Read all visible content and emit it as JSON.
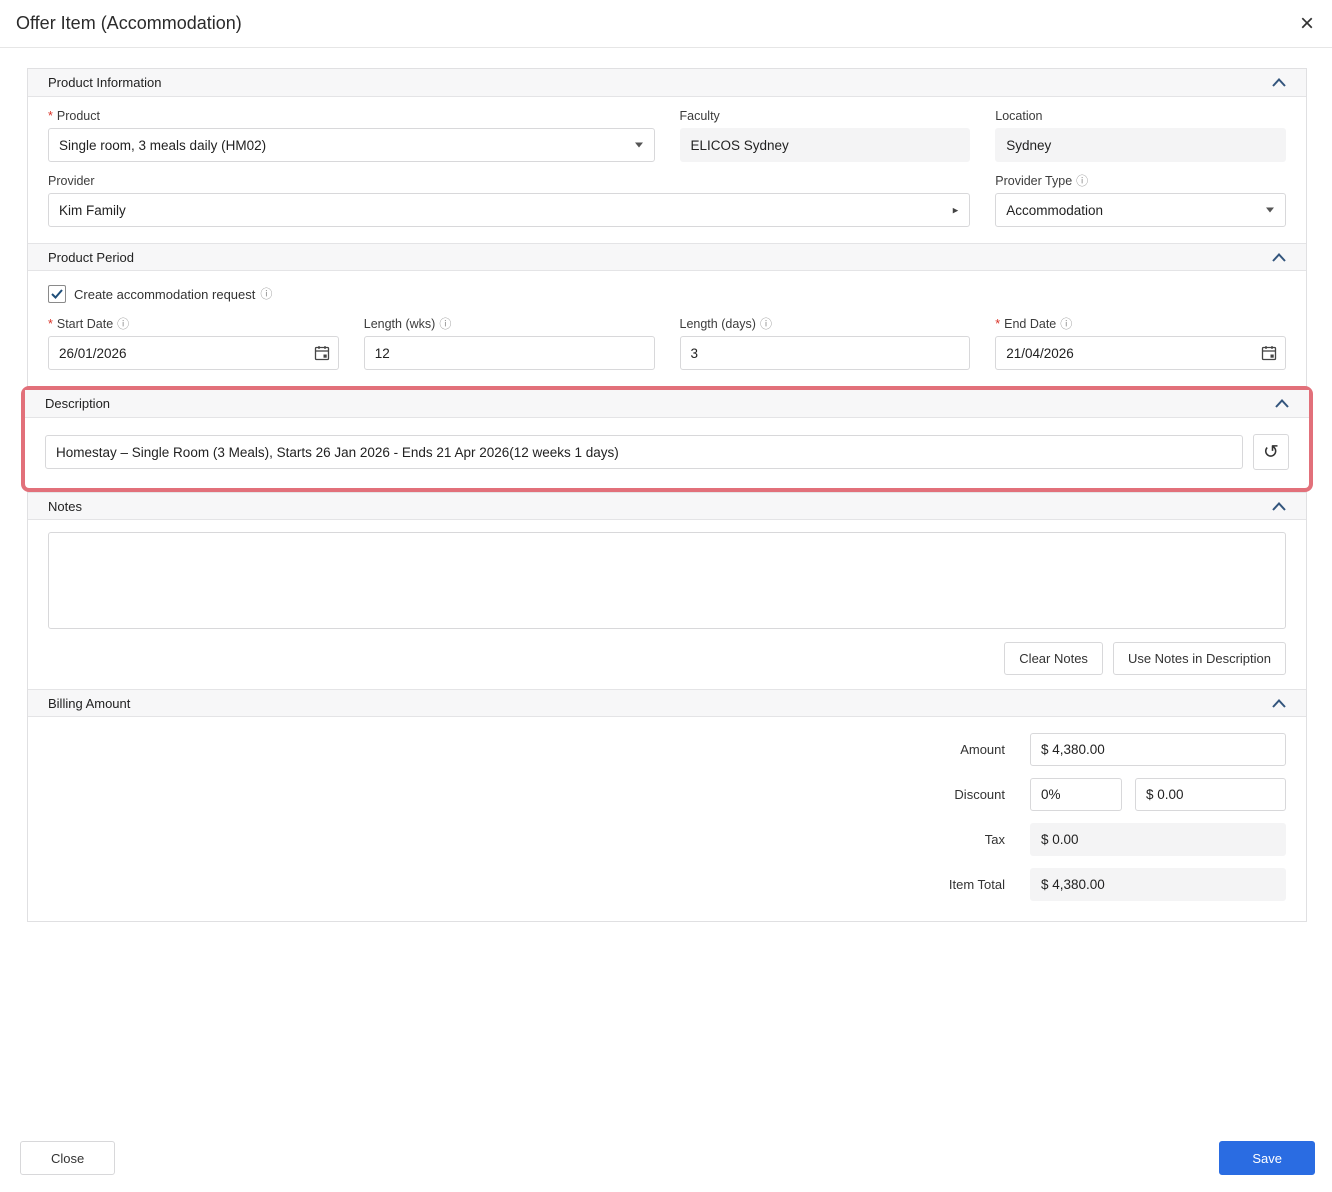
{
  "modal": {
    "title": "Offer Item (Accommodation)"
  },
  "icons": {
    "close": "×",
    "info": "ⓘ",
    "history": "↺",
    "provider_arrow": "▸"
  },
  "marks": {
    "required": "*"
  },
  "colors": {
    "accent": "#2a6ce2",
    "highlight_border": "#e2707a",
    "required": "#d93025",
    "chevron": "#33557d"
  },
  "product_information": {
    "title": "Product Information",
    "product": {
      "label": "Product",
      "value": "Single room, 3 meals daily (HM02)"
    },
    "faculty": {
      "label": "Faculty",
      "value": "ELICOS Sydney"
    },
    "location": {
      "label": "Location",
      "value": "Sydney"
    },
    "provider": {
      "label": "Provider",
      "value": "Kim Family"
    },
    "provider_type": {
      "label": "Provider Type",
      "value": "Accommodation"
    }
  },
  "product_period": {
    "title": "Product Period",
    "create_request_label": "Create accommodation request",
    "start_date": {
      "label": "Start Date",
      "value": "26/01/2026"
    },
    "length_wks": {
      "label": "Length (wks)",
      "value": "12"
    },
    "length_days": {
      "label": "Length (days)",
      "value": "3"
    },
    "end_date": {
      "label": "End Date",
      "value": "21/04/2026"
    }
  },
  "description": {
    "title": "Description",
    "value": "Homestay – Single Room (3 Meals), Starts 26 Jan 2026 - Ends 21 Apr 2026(12 weeks 1 days)"
  },
  "notes": {
    "title": "Notes",
    "value": "",
    "clear_button": "Clear Notes",
    "use_button": "Use Notes in Description"
  },
  "billing": {
    "title": "Billing Amount",
    "amount": {
      "label": "Amount",
      "value": "$ 4,380.00"
    },
    "discount": {
      "label": "Discount",
      "percent": "0%",
      "value": "$ 0.00"
    },
    "tax": {
      "label": "Tax",
      "value": "$ 0.00"
    },
    "item_total": {
      "label": "Item Total",
      "value": "$ 4,380.00"
    }
  },
  "footer": {
    "close_label": "Close",
    "save_label": "Save"
  }
}
